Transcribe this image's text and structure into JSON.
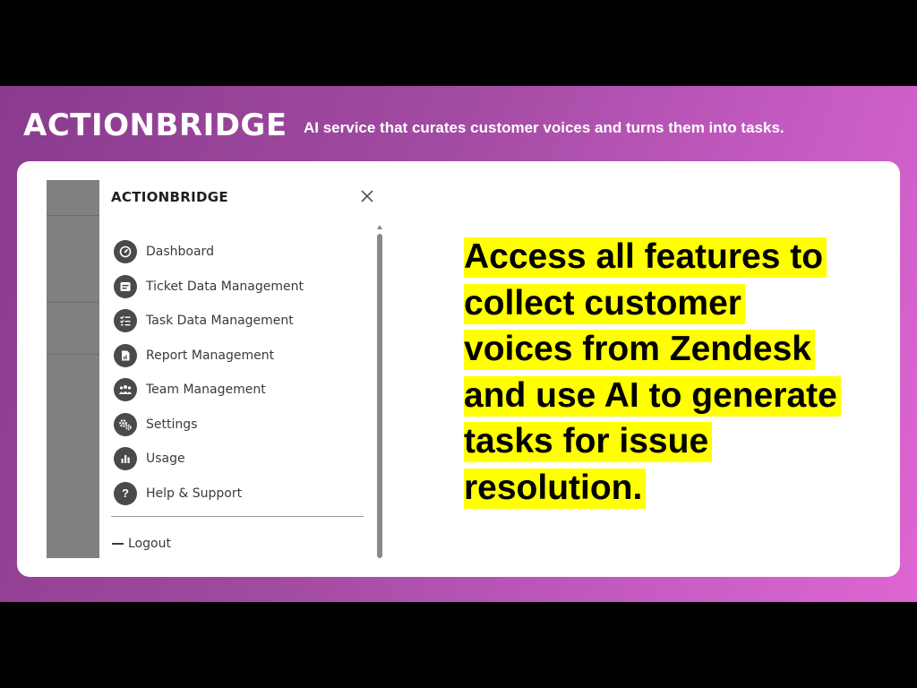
{
  "header": {
    "brand": "ACTIONBRIDGE",
    "tagline": "AI service that curates customer voices and turns them into tasks."
  },
  "menu": {
    "title": "ACTIONBRIDGE",
    "items": [
      {
        "label": "Dashboard",
        "icon": "dashboard-icon"
      },
      {
        "label": "Ticket Data Management",
        "icon": "ticket-icon"
      },
      {
        "label": "Task Data Management",
        "icon": "task-list-icon"
      },
      {
        "label": "Report Management",
        "icon": "report-icon"
      },
      {
        "label": "Team Management",
        "icon": "team-icon"
      },
      {
        "label": "Settings",
        "icon": "gears-icon"
      },
      {
        "label": "Usage",
        "icon": "bar-chart-icon"
      },
      {
        "label": "Help & Support",
        "icon": "question-icon"
      }
    ],
    "logout_label": "Logout"
  },
  "headline": {
    "lines": [
      "Access all features to",
      "collect customer",
      "voices from Zendesk",
      "and use AI to generate",
      "tasks for issue",
      "resolution."
    ]
  },
  "colors": {
    "highlight": "#ffff00",
    "icon_bg": "#4a4a4a",
    "banner_start": "#8a3b8f",
    "banner_end": "#de66d2"
  }
}
